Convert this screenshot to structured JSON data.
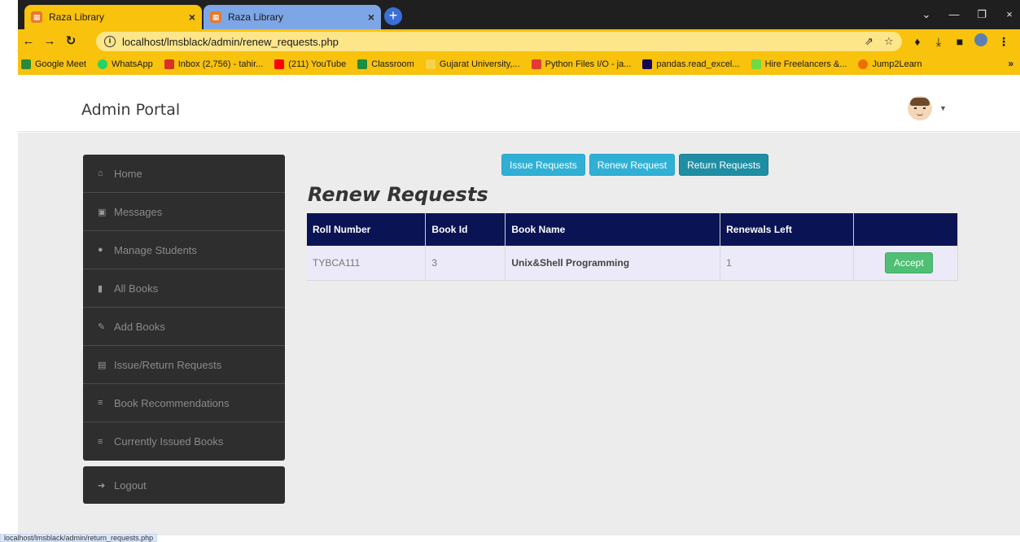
{
  "browser": {
    "tabs": [
      {
        "title": "Raza Library",
        "active": true
      },
      {
        "title": "Raza Library",
        "active": false
      }
    ],
    "url": "localhost/lmsblack/admin/renew_requests.php",
    "bookmarks": [
      {
        "label": "Google Meet",
        "color": "#2a8a3a"
      },
      {
        "label": "WhatsApp",
        "color": "#25d366"
      },
      {
        "label": "Inbox (2,756) - tahir...",
        "color": "#d93025"
      },
      {
        "label": "(211) YouTube",
        "color": "#ff0000"
      },
      {
        "label": "Classroom",
        "color": "#1e8e3e"
      },
      {
        "label": "Gujarat University,...",
        "color": "#f8c20d"
      },
      {
        "label": "Python Files I/O - ja...",
        "color": "#e53935"
      },
      {
        "label": "pandas.read_excel...",
        "color": "#150458"
      },
      {
        "label": "Hire Freelancers &...",
        "color": "#6fda44"
      },
      {
        "label": "Jump2Learn",
        "color": "#ef6c00"
      }
    ],
    "status_url": "localhost/lmsblack/admin/return_requests.php"
  },
  "header": {
    "brand": "Admin Portal"
  },
  "sidebar": {
    "items": [
      {
        "label": "Home",
        "icon": "home-icon"
      },
      {
        "label": "Messages",
        "icon": "inbox-icon"
      },
      {
        "label": "Manage Students",
        "icon": "user-icon"
      },
      {
        "label": "All Books",
        "icon": "book-icon"
      },
      {
        "label": "Add Books",
        "icon": "edit-icon"
      },
      {
        "label": "Issue/Return Requests",
        "icon": "list-icon"
      },
      {
        "label": "Book Recommendations",
        "icon": "list-icon"
      },
      {
        "label": "Currently Issued Books",
        "icon": "list-icon"
      }
    ],
    "logout": "Logout"
  },
  "requests_nav": {
    "issue": "Issue Requests",
    "renew": "Renew Request",
    "return": "Return Requests"
  },
  "main": {
    "title": "Renew Requests",
    "columns": [
      "Roll Number",
      "Book Id",
      "Book Name",
      "Renewals Left",
      ""
    ],
    "rows": [
      {
        "roll": "TYBCA111",
        "book_id": "3",
        "book_name": "Unix&Shell Programming",
        "renewals_left": "1",
        "action": "Accept"
      }
    ]
  }
}
